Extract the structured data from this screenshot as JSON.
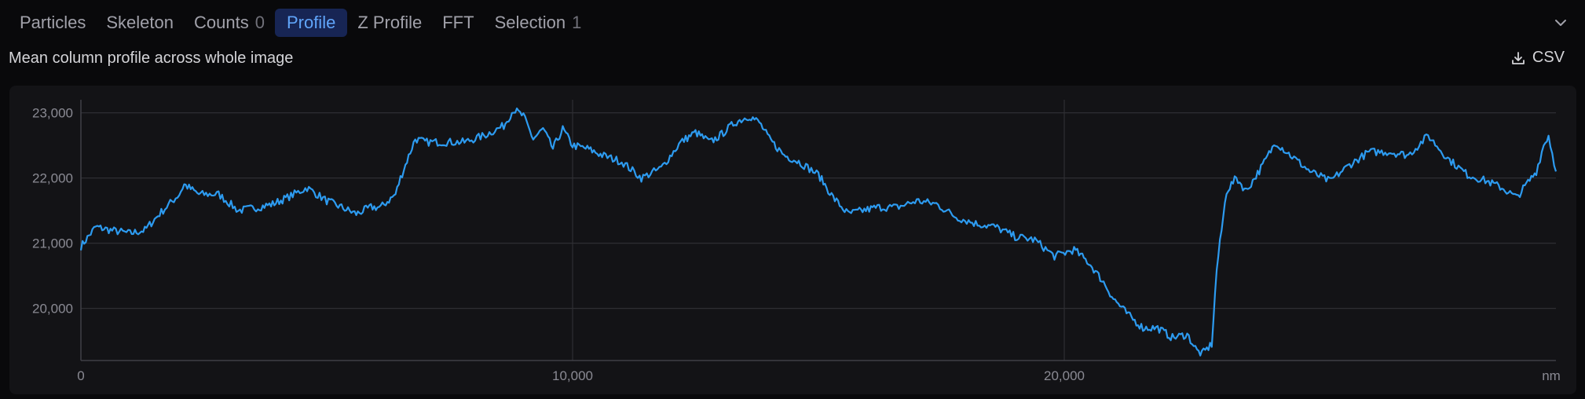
{
  "tabs": [
    {
      "label": "Particles",
      "count": null,
      "active": false
    },
    {
      "label": "Skeleton",
      "count": null,
      "active": false
    },
    {
      "label": "Counts",
      "count": "0",
      "active": false
    },
    {
      "label": "Profile",
      "count": null,
      "active": true
    },
    {
      "label": "Z Profile",
      "count": null,
      "active": false
    },
    {
      "label": "FFT",
      "count": null,
      "active": false
    },
    {
      "label": "Selection",
      "count": "1",
      "active": false
    }
  ],
  "header": {
    "subtitle": "Mean column profile across whole image",
    "csv_label": "CSV",
    "collapse_icon": "chevron-down-icon",
    "download_icon": "download-icon"
  },
  "colors": {
    "accent": "#60a5fa",
    "line": "#2d9bf0",
    "grid": "#2e2e33",
    "axis_text": "#8a8a93"
  },
  "chart_data": {
    "type": "line",
    "title": "",
    "xlabel": "",
    "ylabel": "",
    "x_unit_label": "nm",
    "xlim": [
      0,
      30000
    ],
    "ylim": [
      19200,
      23200
    ],
    "x_ticks": [
      0,
      10000,
      20000
    ],
    "x_tick_labels": [
      "0",
      "10,000",
      "20,000"
    ],
    "y_ticks": [
      20000,
      21000,
      22000,
      23000
    ],
    "y_tick_labels": [
      "20,000",
      "21,000",
      "22,000",
      "23,000"
    ],
    "grid": true,
    "legend": "none",
    "series": [
      {
        "x": [
          0,
          300,
          600,
          1000,
          1300,
          1600,
          2000,
          2100,
          2400,
          2800,
          3200,
          3600,
          3900,
          4200,
          4600,
          5000,
          5300,
          5600,
          5900,
          6100,
          6400,
          6500,
          6800,
          7000,
          7400,
          7800,
          8200,
          8600,
          8800,
          9000,
          9200,
          9400,
          9600,
          9800,
          10000,
          10300,
          10600,
          11000,
          11400,
          11800,
          12200,
          12500,
          12800,
          13000,
          13300,
          13600,
          13800,
          14000,
          14300,
          14600,
          15000,
          15300,
          15600,
          15900,
          16200,
          16600,
          17000,
          17400,
          17800,
          18200,
          18600,
          19000,
          19400,
          19800,
          20200,
          20500,
          20800,
          21000,
          21300,
          21600,
          21900,
          22200,
          22500,
          22700,
          22800,
          23000,
          23100,
          23300,
          23500,
          23700,
          24000,
          24300,
          24600,
          25000,
          25400,
          25800,
          26200,
          26600,
          27000,
          27400,
          27800,
          28200,
          28600,
          28900,
          29200,
          29400,
          29600,
          29750,
          29850,
          30000
        ],
        "y": [
          20950,
          21250,
          21200,
          21150,
          21200,
          21450,
          21750,
          21900,
          21750,
          21750,
          21500,
          21550,
          21600,
          21700,
          21850,
          21650,
          21550,
          21450,
          21550,
          21550,
          21750,
          22000,
          22600,
          22550,
          22550,
          22550,
          22650,
          22800,
          23050,
          22950,
          22600,
          22750,
          22450,
          22750,
          22500,
          22450,
          22350,
          22250,
          22000,
          22150,
          22550,
          22700,
          22550,
          22650,
          22850,
          22950,
          22850,
          22600,
          22350,
          22250,
          22050,
          21700,
          21450,
          21500,
          21550,
          21550,
          21650,
          21600,
          21400,
          21300,
          21250,
          21100,
          21050,
          20800,
          20900,
          20700,
          20400,
          20150,
          19900,
          19700,
          19700,
          19550,
          19600,
          19350,
          19300,
          19450,
          20600,
          21800,
          22000,
          21800,
          22150,
          22550,
          22350,
          22100,
          21950,
          22200,
          22400,
          22400,
          22350,
          22650,
          22300,
          22050,
          21950,
          21850,
          21700,
          21900,
          22100,
          22500,
          22650,
          22100
        ]
      }
    ]
  }
}
